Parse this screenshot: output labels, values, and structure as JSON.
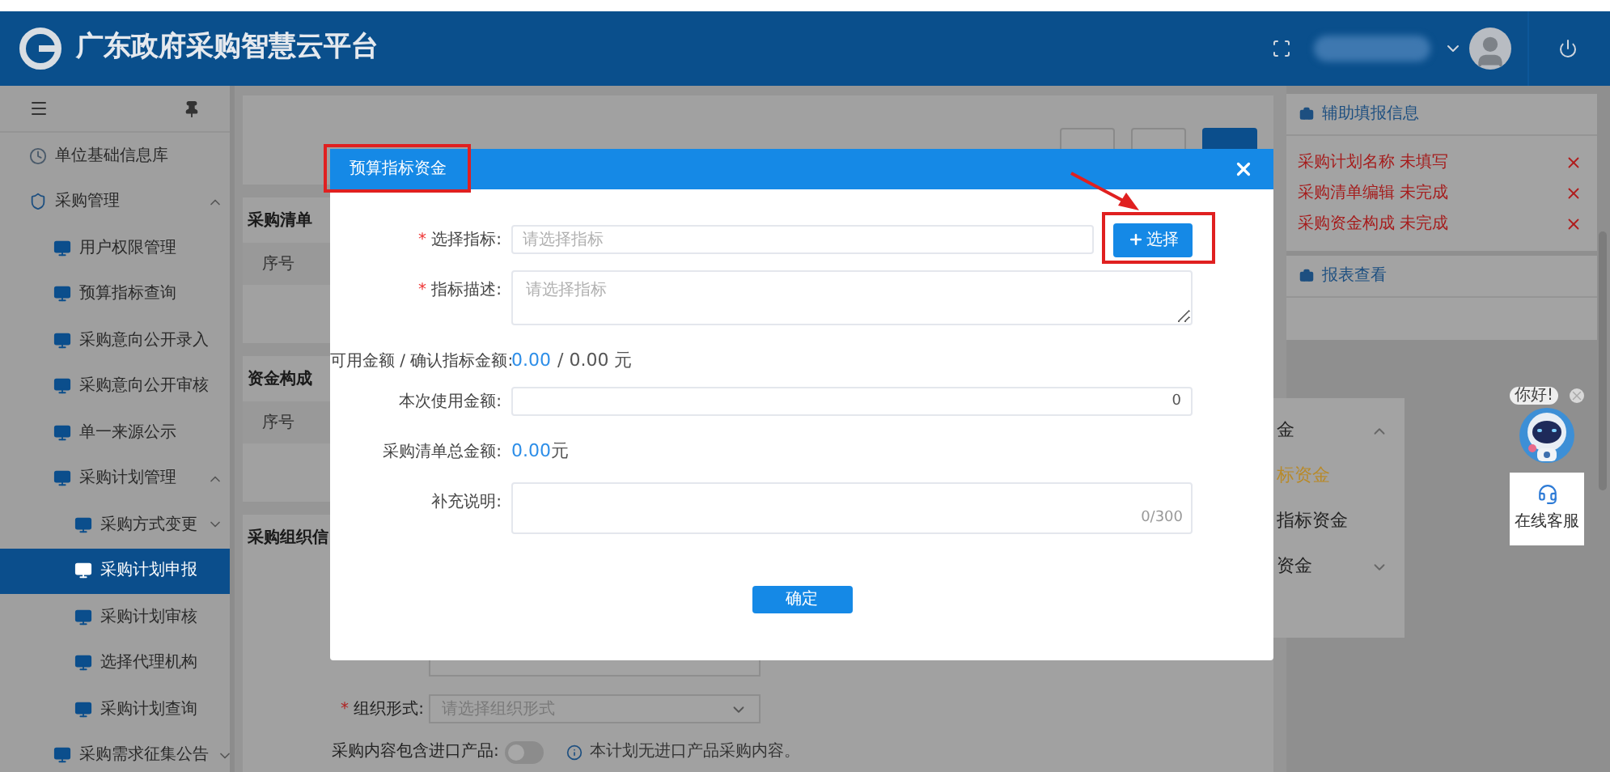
{
  "header": {
    "title": "广东政府采购智慧云平台"
  },
  "sidebar": {
    "items": [
      {
        "label": "单位基础信息库",
        "kind": "page",
        "selected": false
      },
      {
        "label": "采购管理",
        "kind": "group",
        "expanded": true,
        "selected": false,
        "children": [
          {
            "label": "用户权限管理",
            "kind": "page",
            "selected": false
          },
          {
            "label": "预算指标查询",
            "kind": "page",
            "selected": false
          },
          {
            "label": "采购意向公开录入",
            "kind": "page",
            "selected": false
          },
          {
            "label": "采购意向公开审核",
            "kind": "page",
            "selected": false
          },
          {
            "label": "单一来源公示",
            "kind": "page",
            "selected": false
          },
          {
            "label": "采购计划管理",
            "kind": "group",
            "expanded": true,
            "selected": false,
            "children": [
              {
                "label": "采购方式变更",
                "kind": "group",
                "expanded": false,
                "selected": false
              },
              {
                "label": "采购计划申报",
                "kind": "page",
                "selected": true
              },
              {
                "label": "采购计划审核",
                "kind": "page",
                "selected": false
              },
              {
                "label": "选择代理机构",
                "kind": "page",
                "selected": false
              },
              {
                "label": "采购计划查询",
                "kind": "page",
                "selected": false
              }
            ]
          },
          {
            "label": "采购需求征集公告",
            "kind": "group",
            "expanded": false,
            "selected": false
          }
        ]
      }
    ]
  },
  "main": {
    "actions": [
      {
        "kind": "default"
      },
      {
        "kind": "default"
      },
      {
        "kind": "primary"
      }
    ],
    "sections": [
      {
        "title": "采购清单",
        "columns": [
          "序号"
        ]
      },
      {
        "title": "资金构成",
        "columns": [
          "序号"
        ]
      },
      {
        "title": "采购组织信"
      }
    ],
    "org_form": {
      "mark": "*",
      "label": "组织形式:",
      "placeholder": "请选择组织形式"
    },
    "import_switch": {
      "label": "采购内容包含进口产品:",
      "on": false
    },
    "import_note": "本计划无进口产品采购内容。"
  },
  "funds_menu": {
    "items": [
      {
        "label": "金",
        "kind": "group",
        "expanded": true,
        "selected": false
      },
      {
        "label": "标资金",
        "kind": "page",
        "selected": true
      },
      {
        "label": "指标资金",
        "kind": "page",
        "selected": false
      },
      {
        "label": "资金",
        "kind": "group",
        "expanded": false,
        "selected": false
      }
    ]
  },
  "assist": {
    "title": "辅助填报信息",
    "items": [
      "采购计划名称 未填写",
      "采购清单编辑 未完成",
      "采购资金构成 未完成"
    ]
  },
  "report": {
    "title": "报表查看"
  },
  "chat": {
    "bubble": "你好!",
    "label": "在线客服"
  },
  "dialog": {
    "title": "预算指标资金",
    "select_mark": "*",
    "select_label": "选择指标:",
    "select_placeholder": "请选择指标",
    "select_button": "选择",
    "desc_mark": "*",
    "desc_label": "指标描述:",
    "desc_placeholder": "请选择指标",
    "available_label": "可用金额 / 确认指标金额:",
    "available": "0.00",
    "confirmed": "/ 0.00 元",
    "use_label": "本次使用金额:",
    "use_value": "0",
    "total_label": "采购清单总金额:",
    "total": "0.00",
    "total_unit": "元",
    "note_label": "补充说明:",
    "note_count": "0/300",
    "confirm": "确定"
  }
}
